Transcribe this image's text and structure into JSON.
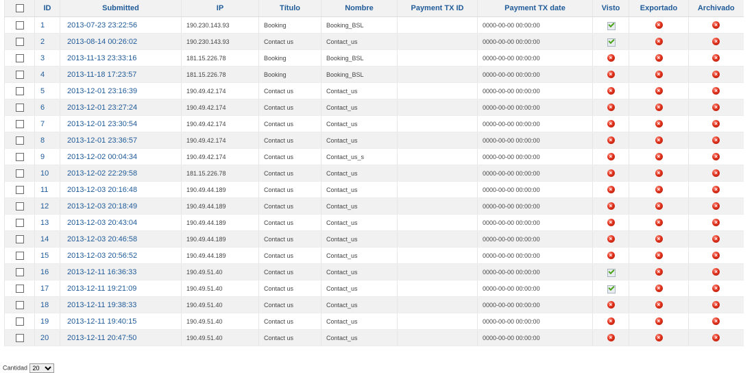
{
  "table": {
    "headers": {
      "id": "ID",
      "submitted": "Submitted",
      "ip": "IP",
      "titulo": "Título",
      "nombre": "Nombre",
      "payment_tx_id": "Payment TX ID",
      "payment_tx_date": "Payment TX date",
      "visto": "Visto",
      "exportado": "Exportado",
      "archivado": "Archivado"
    },
    "rows": [
      {
        "id": "1",
        "submitted": "2013-07-23 23:22:56",
        "ip": "190.230.143.93",
        "titulo": "Booking",
        "nombre": "Booking_BSL",
        "payment_tx_id": "",
        "payment_tx_date": "0000-00-00 00:00:00",
        "visto": "ok-icon",
        "exportado": "x-icon",
        "archivado": "x-icon"
      },
      {
        "id": "2",
        "submitted": "2013-08-14 00:26:02",
        "ip": "190.230.143.93",
        "titulo": "Contact us",
        "nombre": "Contact_us",
        "payment_tx_id": "",
        "payment_tx_date": "0000-00-00 00:00:00",
        "visto": "ok-icon",
        "exportado": "x-icon",
        "archivado": "x-icon"
      },
      {
        "id": "3",
        "submitted": "2013-11-13 23:33:16",
        "ip": "181.15.226.78",
        "titulo": "Booking",
        "nombre": "Booking_BSL",
        "payment_tx_id": "",
        "payment_tx_date": "0000-00-00 00:00:00",
        "visto": "x-icon",
        "exportado": "x-icon",
        "archivado": "x-icon"
      },
      {
        "id": "4",
        "submitted": "2013-11-18 17:23:57",
        "ip": "181.15.226.78",
        "titulo": "Booking",
        "nombre": "Booking_BSL",
        "payment_tx_id": "",
        "payment_tx_date": "0000-00-00 00:00:00",
        "visto": "x-icon",
        "exportado": "x-icon",
        "archivado": "x-icon"
      },
      {
        "id": "5",
        "submitted": "2013-12-01 23:16:39",
        "ip": "190.49.42.174",
        "titulo": "Contact us",
        "nombre": "Contact_us",
        "payment_tx_id": "",
        "payment_tx_date": "0000-00-00 00:00:00",
        "visto": "x-icon",
        "exportado": "x-icon",
        "archivado": "x-icon"
      },
      {
        "id": "6",
        "submitted": "2013-12-01 23:27:24",
        "ip": "190.49.42.174",
        "titulo": "Contact us",
        "nombre": "Contact_us",
        "payment_tx_id": "",
        "payment_tx_date": "0000-00-00 00:00:00",
        "visto": "x-icon",
        "exportado": "x-icon",
        "archivado": "x-icon"
      },
      {
        "id": "7",
        "submitted": "2013-12-01 23:30:54",
        "ip": "190.49.42.174",
        "titulo": "Contact us",
        "nombre": "Contact_us",
        "payment_tx_id": "",
        "payment_tx_date": "0000-00-00 00:00:00",
        "visto": "x-icon",
        "exportado": "x-icon",
        "archivado": "x-icon"
      },
      {
        "id": "8",
        "submitted": "2013-12-01 23:36:57",
        "ip": "190.49.42.174",
        "titulo": "Contact us",
        "nombre": "Contact_us",
        "payment_tx_id": "",
        "payment_tx_date": "0000-00-00 00:00:00",
        "visto": "x-icon",
        "exportado": "x-icon",
        "archivado": "x-icon"
      },
      {
        "id": "9",
        "submitted": "2013-12-02 00:04:34",
        "ip": "190.49.42.174",
        "titulo": "Contact us",
        "nombre": "Contact_us_s",
        "payment_tx_id": "",
        "payment_tx_date": "0000-00-00 00:00:00",
        "visto": "x-icon",
        "exportado": "x-icon",
        "archivado": "x-icon"
      },
      {
        "id": "10",
        "submitted": "2013-12-02 22:29:58",
        "ip": "181.15.226.78",
        "titulo": "Contact us",
        "nombre": "Contact_us",
        "payment_tx_id": "",
        "payment_tx_date": "0000-00-00 00:00:00",
        "visto": "x-icon",
        "exportado": "x-icon",
        "archivado": "x-icon"
      },
      {
        "id": "11",
        "submitted": "2013-12-03 20:16:48",
        "ip": "190.49.44.189",
        "titulo": "Contact us",
        "nombre": "Contact_us",
        "payment_tx_id": "",
        "payment_tx_date": "0000-00-00 00:00:00",
        "visto": "x-icon",
        "exportado": "x-icon",
        "archivado": "x-icon"
      },
      {
        "id": "12",
        "submitted": "2013-12-03 20:18:49",
        "ip": "190.49.44.189",
        "titulo": "Contact us",
        "nombre": "Contact_us",
        "payment_tx_id": "",
        "payment_tx_date": "0000-00-00 00:00:00",
        "visto": "x-icon",
        "exportado": "x-icon",
        "archivado": "x-icon"
      },
      {
        "id": "13",
        "submitted": "2013-12-03 20:43:04",
        "ip": "190.49.44.189",
        "titulo": "Contact us",
        "nombre": "Contact_us",
        "payment_tx_id": "",
        "payment_tx_date": "0000-00-00 00:00:00",
        "visto": "x-icon",
        "exportado": "x-icon",
        "archivado": "x-icon"
      },
      {
        "id": "14",
        "submitted": "2013-12-03 20:46:58",
        "ip": "190.49.44.189",
        "titulo": "Contact us",
        "nombre": "Contact_us",
        "payment_tx_id": "",
        "payment_tx_date": "0000-00-00 00:00:00",
        "visto": "x-icon",
        "exportado": "x-icon",
        "archivado": "x-icon"
      },
      {
        "id": "15",
        "submitted": "2013-12-03 20:56:52",
        "ip": "190.49.44.189",
        "titulo": "Contact us",
        "nombre": "Contact_us",
        "payment_tx_id": "",
        "payment_tx_date": "0000-00-00 00:00:00",
        "visto": "x-icon",
        "exportado": "x-icon",
        "archivado": "x-icon"
      },
      {
        "id": "16",
        "submitted": "2013-12-11 16:36:33",
        "ip": "190.49.51.40",
        "titulo": "Contact us",
        "nombre": "Contact_us",
        "payment_tx_id": "",
        "payment_tx_date": "0000-00-00 00:00:00",
        "visto": "ok-icon",
        "exportado": "x-icon",
        "archivado": "x-icon"
      },
      {
        "id": "17",
        "submitted": "2013-12-11 19:21:09",
        "ip": "190.49.51.40",
        "titulo": "Contact us",
        "nombre": "Contact_us",
        "payment_tx_id": "",
        "payment_tx_date": "0000-00-00 00:00:00",
        "visto": "ok-icon",
        "exportado": "x-icon",
        "archivado": "x-icon"
      },
      {
        "id": "18",
        "submitted": "2013-12-11 19:38:33",
        "ip": "190.49.51.40",
        "titulo": "Contact us",
        "nombre": "Contact_us",
        "payment_tx_id": "",
        "payment_tx_date": "0000-00-00 00:00:00",
        "visto": "x-icon",
        "exportado": "x-icon",
        "archivado": "x-icon"
      },
      {
        "id": "19",
        "submitted": "2013-12-11 19:40:15",
        "ip": "190.49.51.40",
        "titulo": "Contact us",
        "nombre": "Contact_us",
        "payment_tx_id": "",
        "payment_tx_date": "0000-00-00 00:00:00",
        "visto": "x-icon",
        "exportado": "x-icon",
        "archivado": "x-icon"
      },
      {
        "id": "20",
        "submitted": "2013-12-11 20:47:50",
        "ip": "190.49.51.40",
        "titulo": "Contact us",
        "nombre": "Contact_us",
        "payment_tx_id": "",
        "payment_tx_date": "0000-00-00 00:00:00",
        "visto": "x-icon",
        "exportado": "x-icon",
        "archivado": "x-icon"
      }
    ]
  },
  "footer": {
    "cantidad_label": "Cantidad",
    "cantidad_value": "20"
  },
  "colors": {
    "header_text": "#1f5a99",
    "link": "#1f5a99",
    "row_alt": "#f1f1f1",
    "status_no": "#e0311c",
    "status_yes": "#4aa318"
  }
}
